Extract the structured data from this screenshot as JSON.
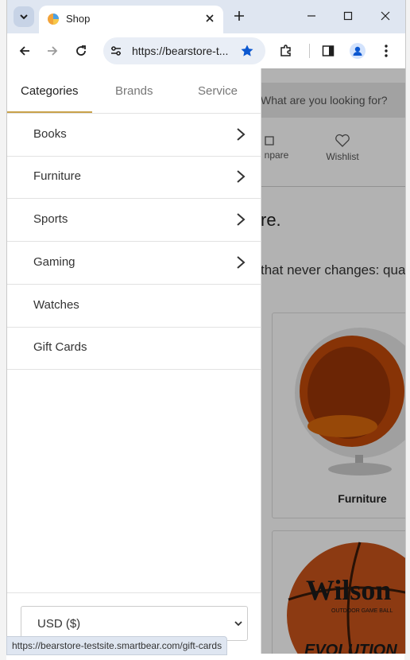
{
  "browser": {
    "tab_title": "Shop",
    "url": "https://bearstore-t...",
    "status_url": "https://bearstore-testsite.smartbear.com/gift-cards"
  },
  "drawer": {
    "tabs": [
      "Categories",
      "Brands",
      "Service"
    ],
    "active_tab": "Categories",
    "menu_items": [
      {
        "label": "Books",
        "has_submenu": true
      },
      {
        "label": "Furniture",
        "has_submenu": true
      },
      {
        "label": "Sports",
        "has_submenu": true
      },
      {
        "label": "Gaming",
        "has_submenu": true
      },
      {
        "label": "Watches",
        "has_submenu": false
      },
      {
        "label": "Gift Cards",
        "has_submenu": false
      }
    ],
    "currency": "USD ($)"
  },
  "page": {
    "search_placeholder": "What are you looking for?",
    "compare_label": "npare",
    "wishlist_label": "Wishlist",
    "headline_fragment": "re.",
    "tagline_fragment": "that never changes: qua",
    "cards": [
      {
        "label": "Furniture",
        "image": "ball-chair"
      },
      {
        "label": "",
        "image": "basketball"
      }
    ],
    "basketball_text": {
      "brand": "Wilson",
      "sub": "OUTDOOR GAME BALL",
      "model": "EVOLUTION"
    }
  },
  "colors": {
    "accent": "#c8a24a",
    "tabstrip": "#dfe6f1",
    "star": "#0b57d0"
  }
}
